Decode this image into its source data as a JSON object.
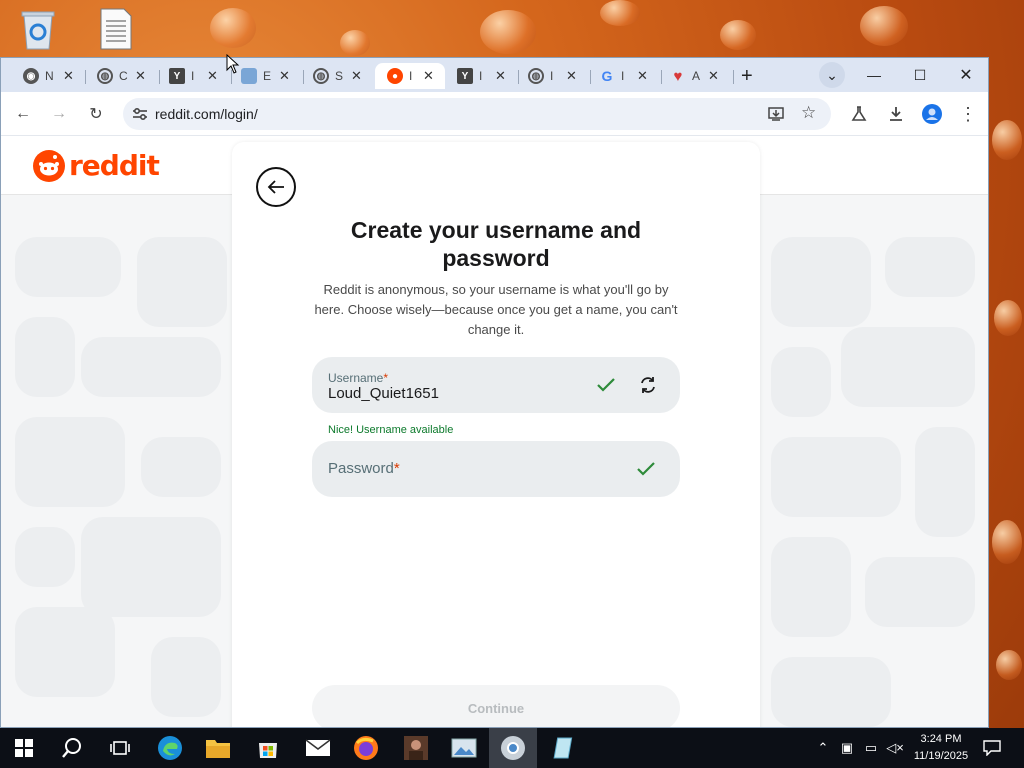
{
  "desktop": {
    "icons": [
      {
        "name": "recycle-bin-icon"
      },
      {
        "name": "document-file-icon"
      }
    ]
  },
  "browser": {
    "tabs": [
      {
        "icon": "chrome-icon",
        "title": "N",
        "active": false
      },
      {
        "icon": "globe-icon",
        "title": "C",
        "active": false
      },
      {
        "icon": "y-combinator-icon",
        "title": "I",
        "active": false
      },
      {
        "icon": "cube-icon",
        "title": "E",
        "active": false
      },
      {
        "icon": "globe-icon",
        "title": "S",
        "active": false
      },
      {
        "icon": "reddit-icon",
        "title": "I",
        "active": true
      },
      {
        "icon": "y-combinator-icon",
        "title": "I",
        "active": false
      },
      {
        "icon": "globe-icon",
        "title": "I",
        "active": false
      },
      {
        "icon": "google-icon",
        "title": "I",
        "active": false
      },
      {
        "icon": "heart-icon",
        "title": "A",
        "active": false
      }
    ],
    "new_tab_label": "+",
    "url": "reddit.com/login/"
  },
  "page": {
    "brand": "reddit",
    "title": "Create your username and password",
    "description": "Reddit is anonymous, so your username is what you'll go by here. Choose wisely—because once you get a name, you can't change it.",
    "username": {
      "label": "Username",
      "required_mark": "*",
      "value": "Loud_Quiet1651",
      "helper": "Nice! Username available"
    },
    "password": {
      "placeholder": "Password",
      "required_mark": "*"
    },
    "continue_label": "Continue"
  },
  "taskbar": {
    "time": "3:24 PM",
    "date": "11/19/2025"
  },
  "colors": {
    "reddit_orange": "#ff4500",
    "success_green": "#0d7a2c",
    "check_green": "#2e8b3a"
  }
}
